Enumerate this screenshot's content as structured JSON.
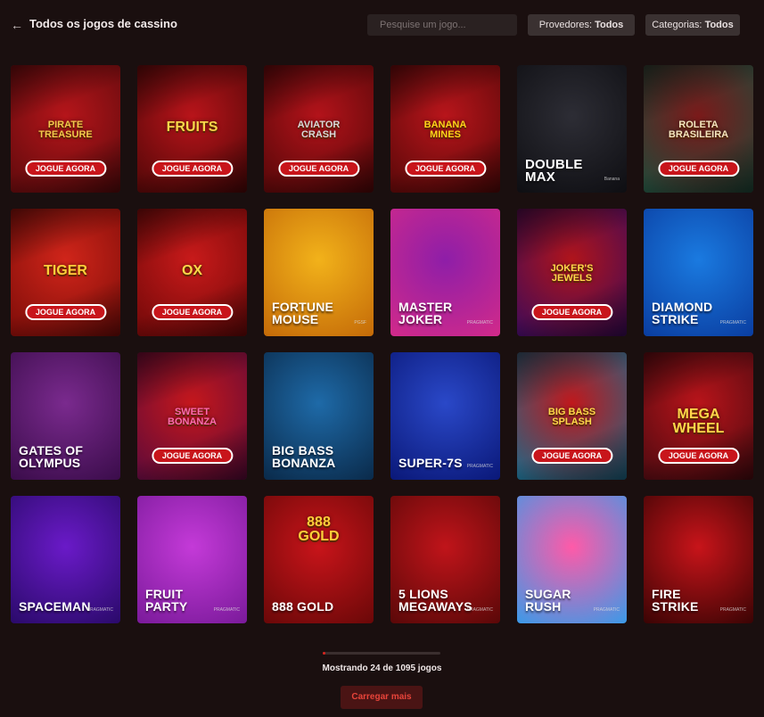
{
  "header": {
    "back_icon": "arrow-left-icon",
    "title": "Todos os jogos de cassino",
    "search_placeholder": "Pesquise um jogo...",
    "providers_label": "Provedores:",
    "providers_value": "Todos",
    "categories_label": "Categorias:",
    "categories_value": "Todos"
  },
  "play_label": "JOGUE AGORA",
  "games": [
    {
      "id": "pirate-treasure",
      "logo": "PIRATE\nTREASURE",
      "name": "",
      "play": true,
      "bg": "#b5151a",
      "bg2": "#5c0a0c",
      "logoColor": "#f2c94c"
    },
    {
      "id": "fruits",
      "logo": "FRUITS",
      "name": "",
      "play": true,
      "bg": "#b8141a",
      "bg2": "#4e0707",
      "logoColor": "#f6d64a"
    },
    {
      "id": "aviator-crash",
      "logo": "AVIATOR\nCRASH",
      "name": "",
      "play": true,
      "bg": "#b3131a",
      "bg2": "#520708",
      "logoColor": "#d9d9d9"
    },
    {
      "id": "banana-mines",
      "logo": "BANANA\nMINES",
      "name": "",
      "play": true,
      "bg": "#b8151b",
      "bg2": "#560808",
      "logoColor": "#ffd31a"
    },
    {
      "id": "double-max",
      "logo": "",
      "name": "DOUBLE\nMAX",
      "play": false,
      "bg": "#2d2d35",
      "bg2": "#0e0e12",
      "logoColor": "#ffffff",
      "badge": "Banana"
    },
    {
      "id": "roleta-brasileira",
      "logo": "ROLETA\nBRASILEIRA",
      "name": "",
      "play": true,
      "bg": "#7a1a1a",
      "bg2": "#1e4a3a",
      "logoColor": "#f5e6c0"
    },
    {
      "id": "fortune-tiger",
      "logo": "TIGER",
      "name": "",
      "play": true,
      "bg": "#d0251a",
      "bg2": "#7a0c08",
      "logoColor": "#ffcf3a"
    },
    {
      "id": "fortune-ox",
      "logo": "OX",
      "name": "",
      "play": true,
      "bg": "#c81a1a",
      "bg2": "#6e0808",
      "logoColor": "#ffd84a"
    },
    {
      "id": "fortune-mouse",
      "logo": "",
      "name": "FORTUNE\nMOUSE",
      "play": false,
      "bg": "#f2b21a",
      "bg2": "#c46a08",
      "logoColor": "#ffffff",
      "badge": "PGSF"
    },
    {
      "id": "master-joker",
      "logo": "",
      "name": "MASTER\nJOKER",
      "play": false,
      "bg": "#8e1ea8",
      "bg2": "#d22a8a",
      "logoColor": "#ffffff",
      "badge": "PRAGMATIC"
    },
    {
      "id": "jokers-jewels",
      "logo": "Joker's\nJewels",
      "name": "",
      "play": true,
      "bg": "#b0141b",
      "bg2": "#3a0a5a",
      "logoColor": "#ffd84a"
    },
    {
      "id": "diamond-strike",
      "logo": "",
      "name": "DIAMOND\nSTRIKE",
      "play": false,
      "bg": "#1a7ae0",
      "bg2": "#0a3da0",
      "logoColor": "#ffffff",
      "badge": "PRAGMATIC"
    },
    {
      "id": "gates-of-olympus",
      "logo": "",
      "name": "GATES OF\nOLYMPUS",
      "play": false,
      "bg": "#7a2a8e",
      "bg2": "#3a0c4a",
      "logoColor": "#ffffff"
    },
    {
      "id": "sweet-bonanza",
      "logo": "SWEET\nBONANZA",
      "name": "",
      "play": true,
      "bg": "#c5171c",
      "bg2": "#5a0a3a",
      "logoColor": "#ff6ab0"
    },
    {
      "id": "big-bass-bonanza",
      "logo": "",
      "name": "BIG BASS\nBONANZA",
      "play": false,
      "bg": "#1e6aa8",
      "bg2": "#0a2a4a",
      "logoColor": "#ffffff"
    },
    {
      "id": "super-7s",
      "logo": "",
      "name": "SUPER-7S",
      "play": false,
      "bg": "#2a48c8",
      "bg2": "#0a1878",
      "logoColor": "#ffffff",
      "badge": "PRAGMATIC"
    },
    {
      "id": "big-bass-splash",
      "logo": "BIG BASS\nSPLASH",
      "name": "",
      "play": true,
      "bg": "#c0181c",
      "bg2": "#1a6a8a",
      "logoColor": "#ffd84a"
    },
    {
      "id": "mega-wheel",
      "logo": "Mega\nWheel",
      "name": "",
      "play": true,
      "bg": "#b8141a",
      "bg2": "#4a0a10",
      "logoColor": "#ffd84a"
    },
    {
      "id": "spaceman",
      "logo": "",
      "name": "SPACEMAN",
      "play": false,
      "bg": "#6a1ac8",
      "bg2": "#2a0a6a",
      "logoColor": "#ffffff",
      "badge": "PRAGMATIC"
    },
    {
      "id": "fruit-party",
      "logo": "",
      "name": "FRUIT\nPARTY",
      "play": false,
      "bg": "#c43ad8",
      "bg2": "#7a1a9a",
      "logoColor": "#ffffff",
      "badge": "PRAGMATIC"
    },
    {
      "id": "888-gold",
      "logo": "888\nGOLD",
      "name": "888 GOLD",
      "play": false,
      "bg": "#c8141a",
      "bg2": "#6a0808",
      "logoColor": "#ffcf3a"
    },
    {
      "id": "5-lions-megaways",
      "logo": "",
      "name": "5 LIONS\nMEGAWAYS",
      "play": false,
      "bg": "#c0141a",
      "bg2": "#5a0808",
      "logoColor": "#ffffff",
      "badge": "PRAGMATIC"
    },
    {
      "id": "sugar-rush",
      "logo": "",
      "name": "SUGAR\nRUSH",
      "play": false,
      "bg": "#ff5aa8",
      "bg2": "#3a9ae8",
      "logoColor": "#ffffff",
      "badge": "PRAGMATIC"
    },
    {
      "id": "fire-strike",
      "logo": "",
      "name": "FIRE\nSTRIKE",
      "play": false,
      "bg": "#c8141a",
      "bg2": "#3a0404",
      "logoColor": "#ffffff",
      "badge": "PRAGMATIC"
    }
  ],
  "footer": {
    "progress_fraction": 0.022,
    "count_text": "Mostrando 24 de 1095 jogos",
    "load_more": "Carregar mais"
  },
  "colors": {
    "accent": "#d9241e",
    "page_bg": "#1a0f0f"
  }
}
